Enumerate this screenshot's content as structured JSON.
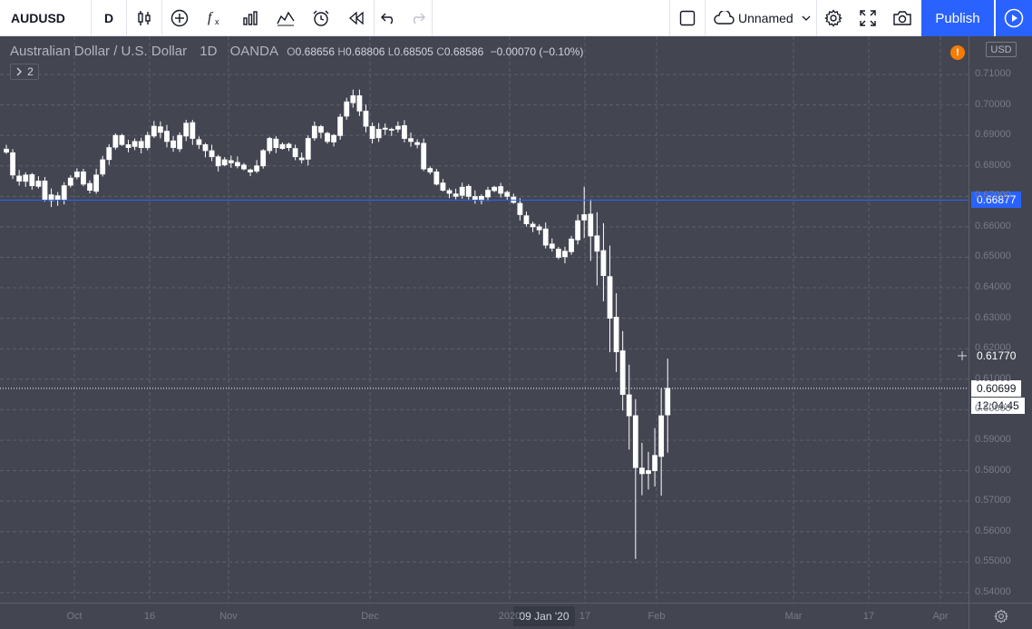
{
  "toolbar": {
    "symbol": "AUDUSD",
    "interval": "D",
    "layout_name": "Unnamed",
    "publish_label": "Publish"
  },
  "legend": {
    "title": "Australian Dollar / U.S. Dollar",
    "interval": "1D",
    "source": "OANDA",
    "o_label": "O",
    "o_value": "0.68656",
    "h_label": "H",
    "h_value": "0.68806",
    "l_label": "L",
    "l_value": "0.68505",
    "c_label": "C",
    "c_value": "0.68586",
    "change": "−0.00070 (−0.10%)",
    "indicators_count": "2",
    "alert_glyph": "!"
  },
  "price_axis": {
    "currency": "USD",
    "ticks": [
      "0.71000",
      "0.70000",
      "0.69000",
      "0.68000",
      "0.67000",
      "0.66000",
      "0.65000",
      "0.64000",
      "0.63000",
      "0.62000",
      "0.61000",
      "0.60000",
      "0.59000",
      "0.58000",
      "0.57000",
      "0.56000",
      "0.55000",
      "0.54000"
    ]
  },
  "time_axis": {
    "ticks": [
      {
        "label": "Oct",
        "x": 82
      },
      {
        "label": "16",
        "x": 165
      },
      {
        "label": "Nov",
        "x": 252
      },
      {
        "label": "Dec",
        "x": 408
      },
      {
        "label": "2020",
        "x": 562
      },
      {
        "label": "17",
        "x": 645
      },
      {
        "label": "Feb",
        "x": 724
      },
      {
        "label": "Mar",
        "x": 875
      },
      {
        "label": "17",
        "x": 958
      },
      {
        "label": "Apr",
        "x": 1037
      }
    ],
    "crosshair_label": "09 Jan '20"
  },
  "markers": {
    "horizontal_line_price": "0.66877",
    "crosshair_price": "0.61770",
    "last_price": "0.60699",
    "countdown": "12:04:45"
  },
  "colors": {
    "accent": "#2962ff",
    "background": "#434651",
    "candle": "#ffffff",
    "line": "#2962ff",
    "alert": "#f57c00"
  },
  "chart_data": {
    "type": "candlestick",
    "symbol": "AUDUSD",
    "interval": "1D",
    "ylim": [
      0.54,
      0.715
    ],
    "close_path": [
      [
        0.6845,
        19
      ],
      [
        0.677,
        28
      ],
      [
        0.675,
        36
      ],
      [
        0.677,
        43
      ],
      [
        0.6735,
        51
      ],
      [
        0.675,
        58
      ],
      [
        0.669,
        66
      ],
      [
        0.6705,
        73
      ],
      [
        0.669,
        81
      ],
      [
        0.6735,
        88
      ],
      [
        0.676,
        96
      ],
      [
        0.678,
        103
      ],
      [
        0.674,
        111
      ],
      [
        0.672,
        118
      ],
      [
        0.677,
        126
      ],
      [
        0.682,
        133
      ],
      [
        0.686,
        141
      ],
      [
        0.69,
        148
      ],
      [
        0.687,
        156
      ],
      [
        0.686,
        163
      ],
      [
        0.688,
        171
      ],
      [
        0.686,
        178
      ],
      [
        0.69,
        186
      ],
      [
        0.693,
        193
      ],
      [
        0.691,
        201
      ],
      [
        0.688,
        208
      ],
      [
        0.686,
        216
      ],
      [
        0.69,
        223
      ],
      [
        0.694,
        231
      ],
      [
        0.689,
        238
      ],
      [
        0.687,
        246
      ],
      [
        0.685,
        253
      ],
      [
        0.683,
        261
      ],
      [
        0.68,
        268
      ],
      [
        0.682,
        276
      ],
      [
        0.681,
        283
      ],
      [
        0.68,
        291
      ],
      [
        0.679,
        298
      ],
      [
        0.678,
        306
      ],
      [
        0.68,
        313
      ],
      [
        0.685,
        321
      ],
      [
        0.689,
        328
      ],
      [
        0.686,
        336
      ],
      [
        0.687,
        343
      ],
      [
        0.686,
        351
      ],
      [
        0.683,
        358
      ],
      [
        0.682,
        366
      ],
      [
        0.689,
        373
      ],
      [
        0.693,
        381
      ],
      [
        0.691,
        388
      ],
      [
        0.688,
        396
      ],
      [
        0.69,
        403
      ],
      [
        0.696,
        411
      ],
      [
        0.701,
        418
      ],
      [
        0.703,
        426
      ],
      [
        0.698,
        433
      ],
      [
        0.693,
        441
      ],
      [
        0.689,
        448
      ],
      [
        0.692,
        456
      ],
      [
        0.692,
        463
      ],
      [
        0.692,
        471
      ],
      [
        0.693,
        478
      ],
      [
        0.689,
        486
      ],
      [
        0.688,
        493
      ],
      [
        0.687,
        501
      ],
      [
        0.679,
        508
      ],
      [
        0.678,
        516
      ],
      [
        0.674,
        523
      ],
      [
        0.672,
        531
      ],
      [
        0.671,
        538
      ],
      [
        0.67,
        546
      ],
      [
        0.673,
        553
      ],
      [
        0.67,
        561
      ],
      [
        0.669,
        568
      ],
      [
        0.67,
        576
      ],
      [
        0.672,
        583
      ],
      [
        0.673,
        591
      ],
      [
        0.671,
        598
      ],
      [
        0.67,
        606
      ],
      [
        0.668,
        613
      ],
      [
        0.664,
        621
      ],
      [
        0.661,
        628
      ],
      [
        0.66,
        636
      ],
      [
        0.659,
        643
      ],
      [
        0.654,
        651
      ],
      [
        0.653,
        658
      ],
      [
        0.65,
        666
      ],
      [
        0.652,
        673
      ],
      [
        0.656,
        681
      ],
      [
        0.662,
        688
      ],
      [
        0.664,
        696
      ],
      [
        0.657,
        703
      ],
      [
        0.652,
        711
      ],
      [
        0.644,
        718
      ],
      [
        0.63,
        726
      ],
      [
        0.619,
        733
      ],
      [
        0.605,
        741
      ],
      [
        0.598,
        748
      ],
      [
        0.581,
        756
      ],
      [
        0.579,
        763
      ],
      [
        0.58,
        771
      ],
      [
        0.585,
        778
      ],
      [
        0.598,
        786
      ],
      [
        0.607,
        793
      ]
    ]
  }
}
